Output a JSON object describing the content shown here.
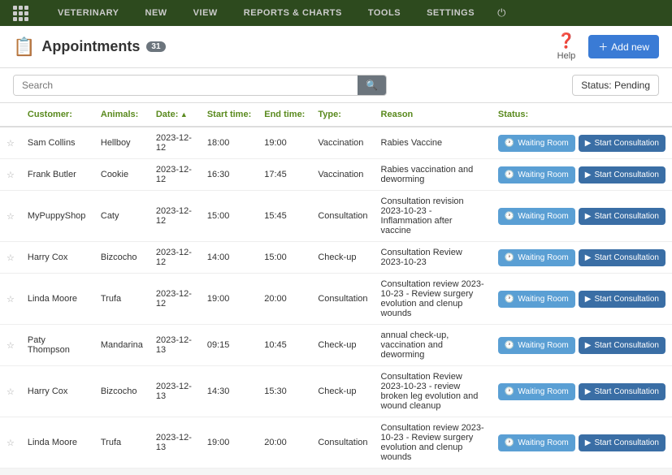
{
  "nav": {
    "items": [
      "VETERINARY",
      "NEW",
      "VIEW",
      "REPORTS & CHARTS",
      "TOOLS",
      "SETTINGS"
    ]
  },
  "header": {
    "title": "Appointments",
    "badge": "31",
    "help_label": "Help",
    "add_new_label": "Add new"
  },
  "search": {
    "placeholder": "Search",
    "status_label": "Status: Pending"
  },
  "table": {
    "columns": [
      {
        "id": "bookmark",
        "label": ""
      },
      {
        "id": "customer",
        "label": "Customer:"
      },
      {
        "id": "animals",
        "label": "Animals:"
      },
      {
        "id": "date",
        "label": "Date:",
        "sort": true
      },
      {
        "id": "start_time",
        "label": "Start time:"
      },
      {
        "id": "end_time",
        "label": "End time:"
      },
      {
        "id": "type",
        "label": "Type:"
      },
      {
        "id": "reason",
        "label": "Reason"
      },
      {
        "id": "status",
        "label": "Status:"
      }
    ],
    "rows": [
      {
        "customer": "Sam Collins",
        "animal": "Hellboy",
        "date": "2023-12-12",
        "start": "18:00",
        "end": "19:00",
        "type": "Vaccination",
        "reason": "Rabies Vaccine"
      },
      {
        "customer": "Frank Butler",
        "animal": "Cookie",
        "date": "2023-12-12",
        "start": "16:30",
        "end": "17:45",
        "type": "Vaccination",
        "reason": "Rabies vaccination and deworming"
      },
      {
        "customer": "MyPuppyShop",
        "animal": "Caty",
        "date": "2023-12-12",
        "start": "15:00",
        "end": "15:45",
        "type": "Consultation",
        "reason": "Consultation revision 2023-10-23 - Inflammation after vaccine"
      },
      {
        "customer": "Harry Cox",
        "animal": "Bizcocho",
        "date": "2023-12-12",
        "start": "14:00",
        "end": "15:00",
        "type": "Check-up",
        "reason": "Consultation Review 2023-10-23"
      },
      {
        "customer": "Linda Moore",
        "animal": "Trufa",
        "date": "2023-12-12",
        "start": "19:00",
        "end": "20:00",
        "type": "Consultation",
        "reason": "Consultation review 2023-10-23 - Review surgery evolution and clenup wounds"
      },
      {
        "customer": "Paty Thompson",
        "animal": "Mandarina",
        "date": "2023-12-13",
        "start": "09:15",
        "end": "10:45",
        "type": "Check-up",
        "reason": "annual check-up, vaccination and deworming"
      },
      {
        "customer": "Harry Cox",
        "animal": "Bizcocho",
        "date": "2023-12-13",
        "start": "14:30",
        "end": "15:30",
        "type": "Check-up",
        "reason": "Consultation Review 2023-10-23 - review broken leg evolution and wound cleanup"
      },
      {
        "customer": "Linda Moore",
        "animal": "Trufa",
        "date": "2023-12-13",
        "start": "19:00",
        "end": "20:00",
        "type": "Consultation",
        "reason": "Consultation review 2023-10-23 - Review surgery evolution and clenup wounds"
      }
    ],
    "waiting_room_label": "Waiting Room",
    "start_consultation_label": "Start Consultation"
  }
}
